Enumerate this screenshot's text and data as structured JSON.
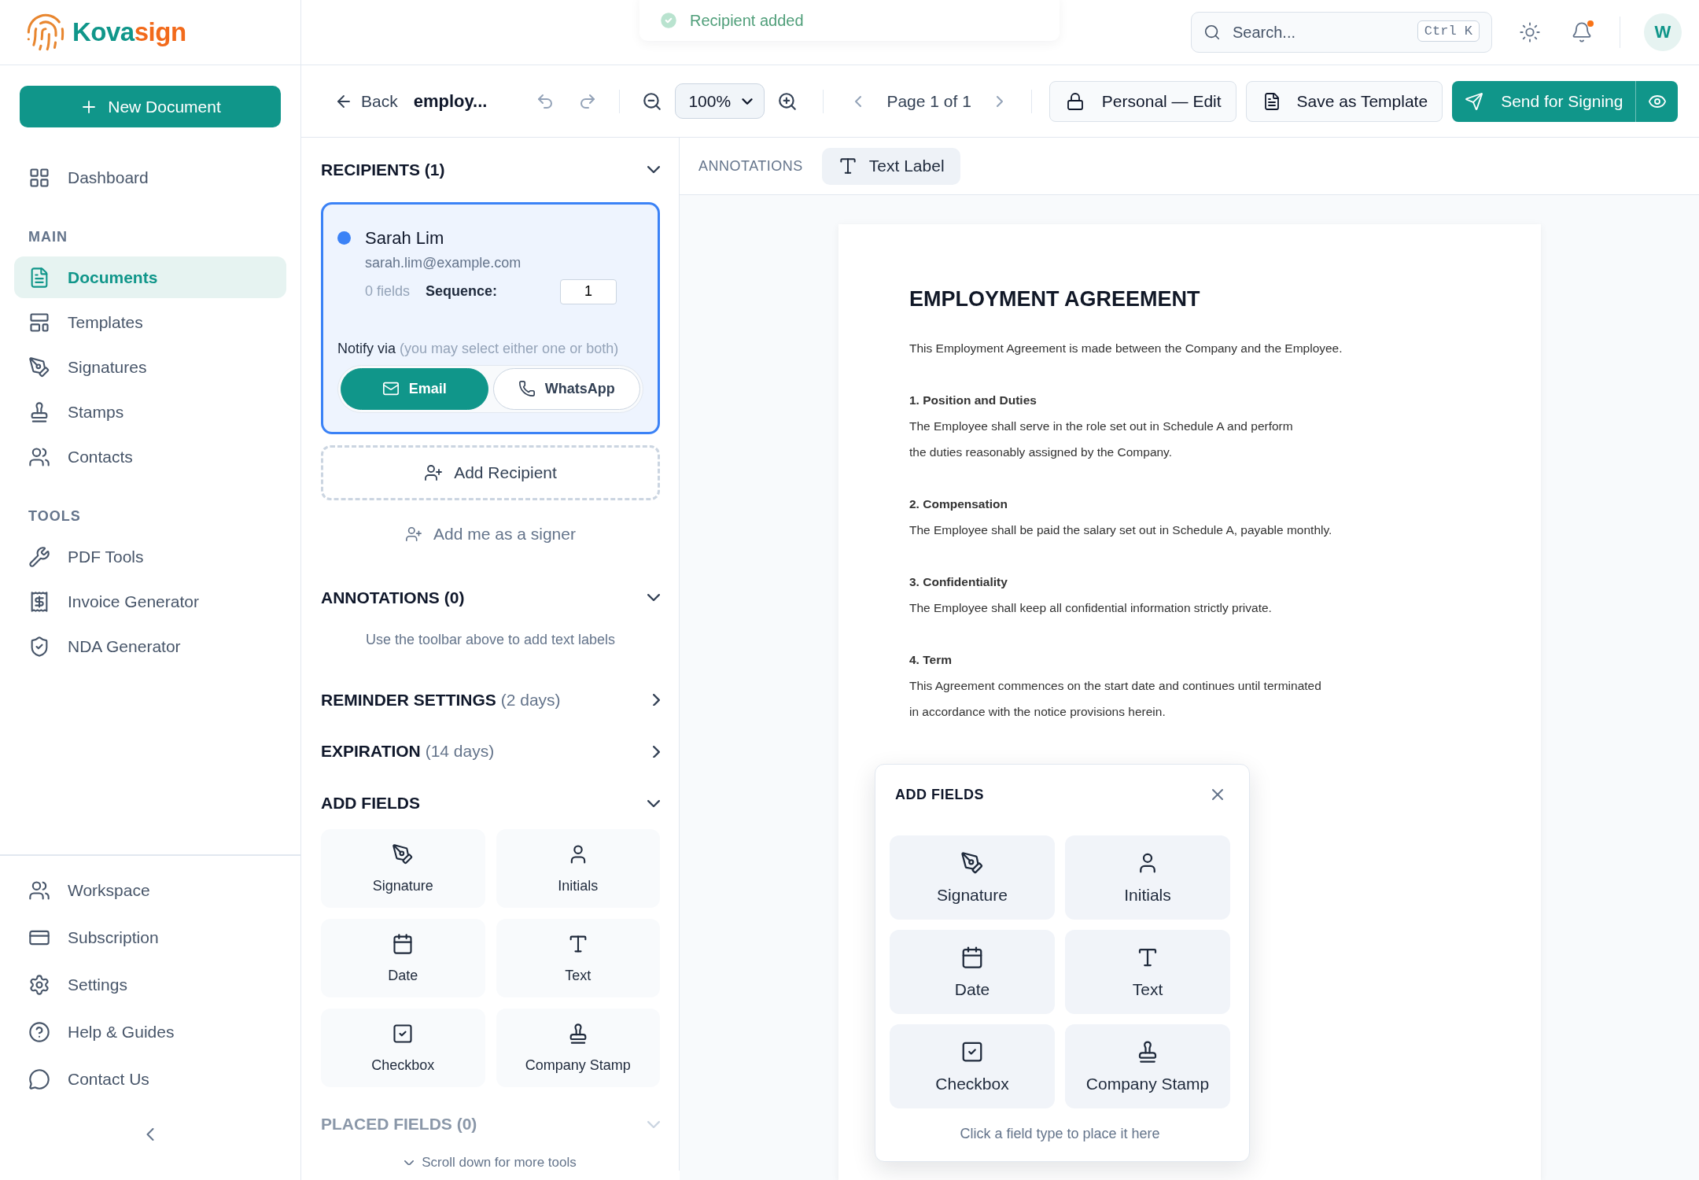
{
  "logo": {
    "primary": "Kova",
    "accent": "sign"
  },
  "toast": {
    "message": "Recipient added"
  },
  "search": {
    "placeholder": "Search...",
    "shortcut": "Ctrl K"
  },
  "notifications": {
    "unread": true
  },
  "user": {
    "initial": "W"
  },
  "sidebar": {
    "new_button": "New Document",
    "top_items": [
      {
        "label": "Dashboard",
        "selected": false
      }
    ],
    "sections": [
      {
        "title": "MAIN",
        "items": [
          {
            "label": "Documents",
            "selected": true
          },
          {
            "label": "Templates",
            "selected": false
          },
          {
            "label": "Signatures",
            "selected": false
          },
          {
            "label": "Stamps",
            "selected": false
          },
          {
            "label": "Contacts",
            "selected": false
          }
        ]
      },
      {
        "title": "TOOLS",
        "items": [
          {
            "label": "PDF Tools",
            "selected": false
          },
          {
            "label": "Invoice Generator",
            "selected": false
          },
          {
            "label": "NDA Generator",
            "selected": false
          }
        ]
      }
    ],
    "bottom_items": [
      {
        "label": "Workspace",
        "selected": false
      },
      {
        "label": "Subscription",
        "selected": false
      },
      {
        "label": "Settings",
        "selected": false
      },
      {
        "label": "Help & Guides",
        "selected": false
      },
      {
        "label": "Contact Us",
        "selected": false
      }
    ]
  },
  "toolbar": {
    "back": "Back",
    "doc_title": "employ...",
    "zoom": "100%",
    "page": "Page 1 of 1",
    "mode": "Personal — Edit",
    "save_template": "Save as Template",
    "send": "Send for Signing"
  },
  "recipients": {
    "title": "RECIPIENTS (1)",
    "expanded": true,
    "items": [
      {
        "name": "Sarah Lim",
        "email": "sarah.lim@example.com",
        "fields": "0 fields",
        "sequence_label": "Sequence:",
        "sequence": "1",
        "selected": true,
        "color": "#3b82f6",
        "notify_label": "Notify via",
        "notify_hint": "(you may select either one or both)",
        "channels": [
          {
            "label": "Email",
            "selected": true
          },
          {
            "label": "WhatsApp",
            "selected": false
          }
        ]
      }
    ],
    "add_button": "Add Recipient",
    "add_me": "Add me as a signer"
  },
  "annotations": {
    "title": "ANNOTATIONS (0)",
    "expanded": true,
    "hint": "Use the toolbar above to add text labels"
  },
  "reminder": {
    "title": "REMINDER SETTINGS",
    "detail": "(2 days)",
    "expanded": false
  },
  "expiration": {
    "title": "EXPIRATION",
    "detail": "(14 days)",
    "expanded": false
  },
  "add_fields": {
    "title": "ADD FIELDS",
    "expanded": true,
    "fields": [
      "Signature",
      "Initials",
      "Date",
      "Text",
      "Checkbox",
      "Company Stamp"
    ]
  },
  "placed_fields": {
    "title": "PLACED FIELDS (0)",
    "expanded": true
  },
  "scroll_hint": "Scroll down for more tools",
  "annotation_bar": {
    "label": "ANNOTATIONS",
    "tool": "Text Label"
  },
  "document": {
    "title": "EMPLOYMENT AGREEMENT",
    "intro": "This Employment Agreement is made between the Company and the Employee.",
    "sections": [
      {
        "heading": "1. Position and Duties",
        "lines": [
          "The Employee shall serve in the role set out in Schedule A and perform",
          "the duties reasonably assigned by the Company."
        ]
      },
      {
        "heading": "2. Compensation",
        "lines": [
          "The Employee shall be paid the salary set out in Schedule A, payable monthly."
        ]
      },
      {
        "heading": "3. Confidentiality",
        "lines": [
          "The Employee shall keep all confidential information strictly private."
        ]
      },
      {
        "heading": "4. Term",
        "lines": [
          "This Agreement commences on the start date and continues until terminated",
          "in accordance with the notice provisions herein."
        ]
      }
    ]
  },
  "popup": {
    "title": "ADD FIELDS",
    "fields": [
      "Signature",
      "Initials",
      "Date",
      "Text",
      "Checkbox",
      "Company Stamp"
    ],
    "hint": "Click a field type to place it here"
  }
}
